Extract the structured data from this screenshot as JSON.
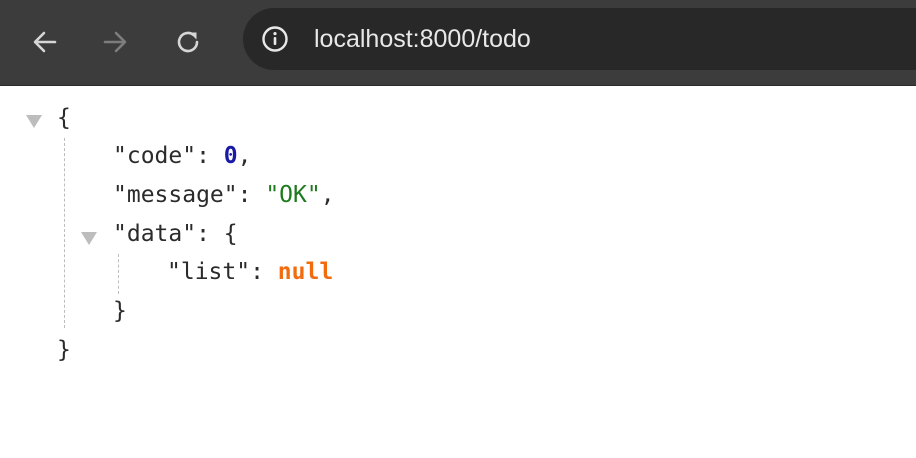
{
  "browser": {
    "url": "localhost:8000/todo",
    "back_icon": "arrow-left-icon",
    "forward_icon": "arrow-right-icon",
    "reload_icon": "reload-icon",
    "info_icon": "info-icon"
  },
  "json_viewer": {
    "open_brace": "{",
    "close_brace": "}",
    "code_key": "\"code\"",
    "code_value": "0",
    "message_key": "\"message\"",
    "message_value": "\"OK\"",
    "data_key": "\"data\"",
    "list_key": "\"list\"",
    "list_value": "null",
    "colon": ": ",
    "comma": ","
  },
  "colors": {
    "toolbar_bg": "#3c3c3c",
    "omnibox_bg": "#282828",
    "number": "#1a1aa6",
    "string": "#1f7a1f",
    "null": "#f26b0f"
  }
}
